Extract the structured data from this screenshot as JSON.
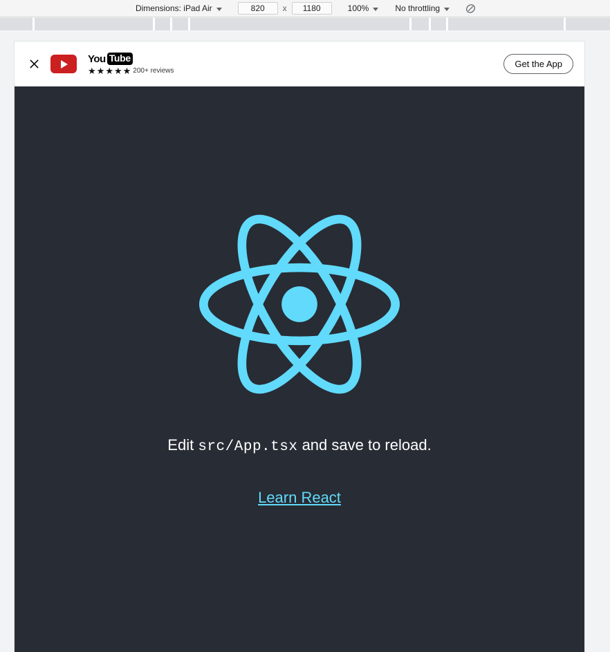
{
  "devtools_toolbar": {
    "dimensions_label": "Dimensions: iPad Air",
    "width_value": "820",
    "height_value": "1180",
    "multiply_symbol": "x",
    "zoom_label": "100%",
    "throttling_label": "No throttling",
    "media_query_icon": "no-media-query-icon",
    "caret_icon": "chevron-down-icon"
  },
  "app_banner": {
    "close_icon": "close-icon",
    "app_logo_icon": "youtube-play-icon",
    "brand_you": "You",
    "brand_tube": "Tube",
    "stars": [
      "★",
      "★",
      "★",
      "★",
      "★"
    ],
    "rating_value": 4.5,
    "reviews_text": "200+ reviews",
    "cta_label": "Get the App"
  },
  "react_app": {
    "logo_icon": "react-atom-logo",
    "edit_prefix": "Edit ",
    "edit_code": "src/App.tsx",
    "edit_suffix": " and save to reload.",
    "link_label": "Learn React"
  },
  "colors": {
    "react_blue": "#61dafb",
    "react_bg": "#282c34",
    "youtube_red": "#cc1f1f",
    "toolbar_bg": "#f5f5f5",
    "chrome_strip_bg": "#dcdee2",
    "banner_bg": "#ffffff"
  }
}
